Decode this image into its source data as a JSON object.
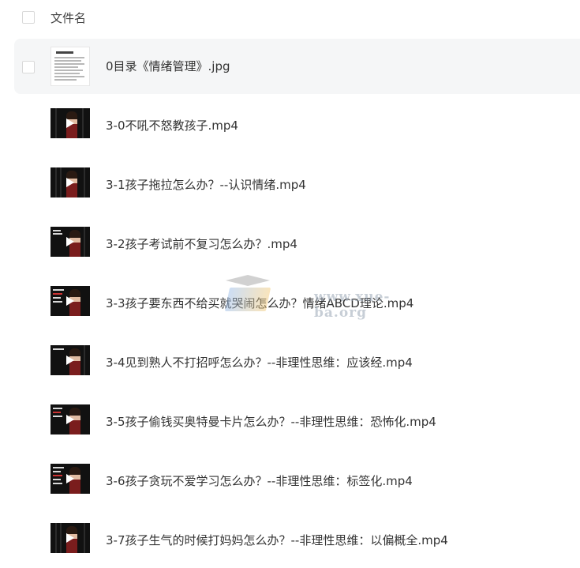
{
  "header": {
    "select_all_label": "",
    "column_title": "文件名"
  },
  "files": [
    {
      "name": "0目录《情绪管理》.jpg",
      "type": "image",
      "selected": true,
      "icon": "image-thumbnail"
    },
    {
      "name": "3-0不吼不怒教孩子.mp4",
      "type": "video",
      "icon": "video-thumbnail"
    },
    {
      "name": "3-1孩子拖拉怎么办？--认识情绪.mp4",
      "type": "video",
      "icon": "video-thumbnail"
    },
    {
      "name": "3-2孩子考试前不复习怎么办？.mp4",
      "type": "video",
      "icon": "video-thumbnail"
    },
    {
      "name": "3-3孩子要东西不给买就哭闹怎么办？情绪ABCD理论.mp4",
      "type": "video",
      "icon": "video-thumbnail"
    },
    {
      "name": "3-4见到熟人不打招呼怎么办？--非理性思维：应该经.mp4",
      "type": "video",
      "icon": "video-thumbnail"
    },
    {
      "name": "3-5孩子偷钱买奥特曼卡片怎么办？--非理性思维：恐怖化.mp4",
      "type": "video",
      "icon": "video-thumbnail"
    },
    {
      "name": "3-6孩子贪玩不爱学习怎么办？--非理性思维：标签化.mp4",
      "type": "video",
      "icon": "video-thumbnail"
    },
    {
      "name": "3-7孩子生气的时候打妈妈怎么办？--非理性思维：以偏概全.mp4",
      "type": "video",
      "icon": "video-thumbnail"
    }
  ],
  "watermark": {
    "text": "www.xue-ba.org",
    "icon": "graduation-cap-logo"
  },
  "colors": {
    "row_selected_bg": "#f5f6f7",
    "text": "#333333",
    "checkbox_border": "#d9d9d9"
  }
}
